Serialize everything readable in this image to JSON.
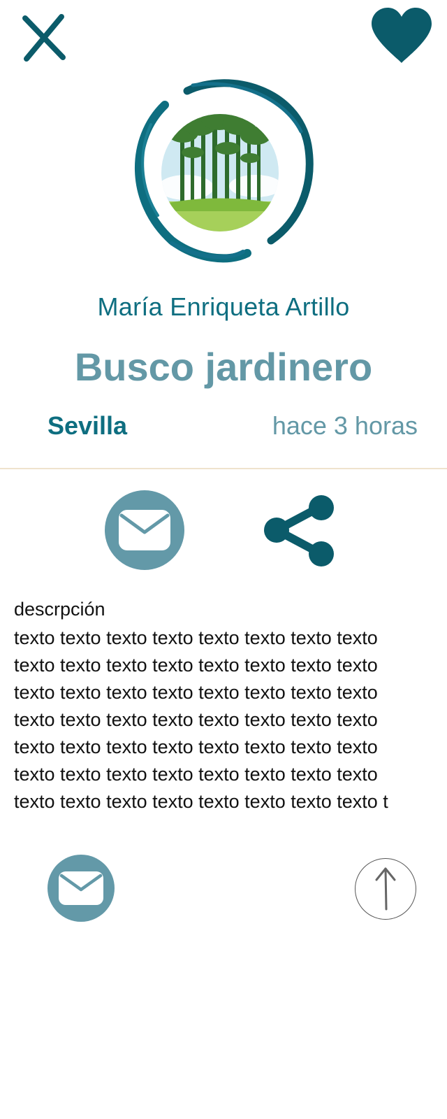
{
  "header": {
    "close_icon": "close-icon",
    "favorite_icon": "heart-icon"
  },
  "profile": {
    "logo_icon": "forest-logo",
    "author_name": "María Enriqueta Artillo"
  },
  "listing": {
    "title": "Busco jardinero",
    "location": "Sevilla",
    "posted": "hace 3 horas",
    "description_label": "descrpción",
    "description_text": "texto texto texto texto texto texto texto texto\ntexto texto texto texto texto texto texto texto\ntexto texto texto texto texto texto texto texto\ntexto texto texto texto texto texto texto texto\ntexto texto texto texto texto texto texto texto\ntexto texto texto texto texto texto texto texto\ntexto texto texto texto texto texto texto texto t"
  },
  "actions": {
    "mail_icon": "mail-icon",
    "share_icon": "share-icon",
    "scroll_top_icon": "arrow-up-icon"
  },
  "colors": {
    "primary_dark": "#0b5b6a",
    "primary": "#0e6e80",
    "muted_teal": "#6398a6",
    "divider": "#efe3cd"
  }
}
